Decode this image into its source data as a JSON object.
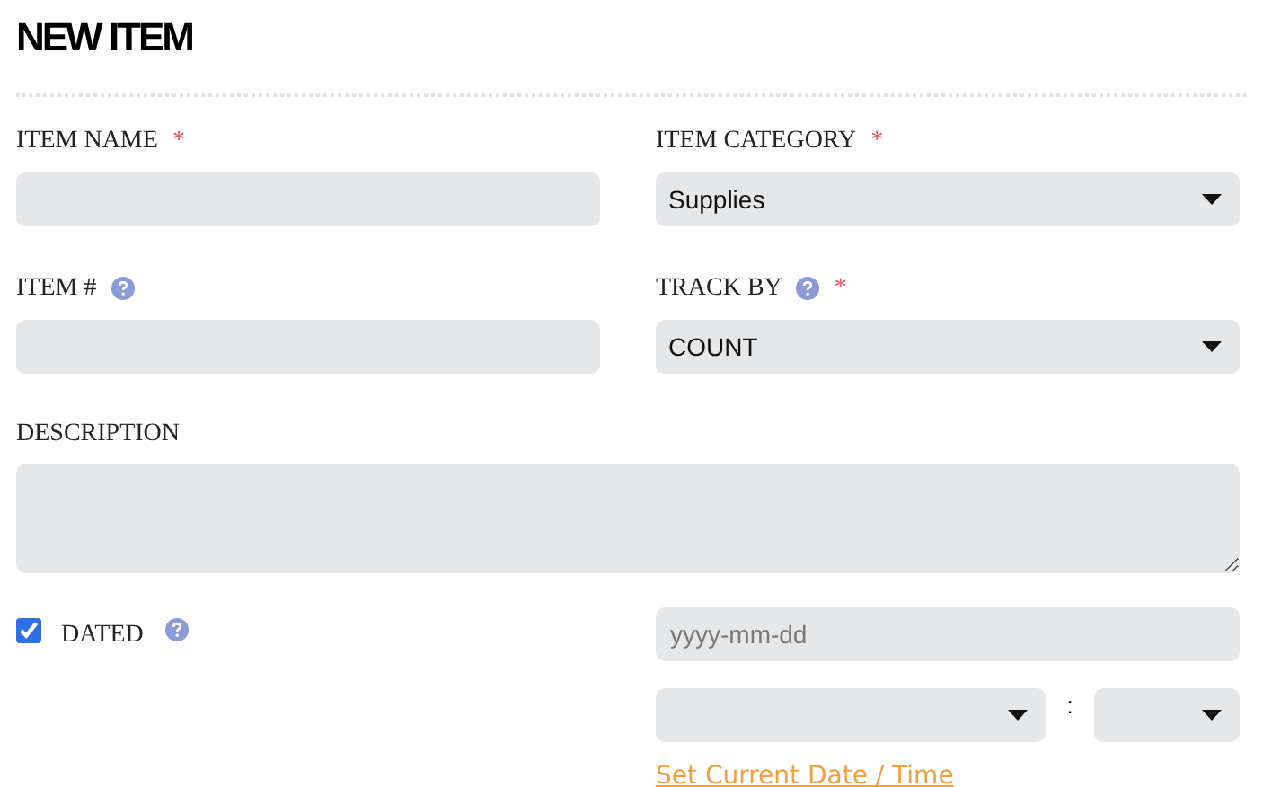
{
  "title": "NEW ITEM",
  "rows": [
    [
      {
        "kind": "text",
        "label": "ITEM NAME",
        "required": true,
        "help": false
      },
      {
        "kind": "select",
        "label": "ITEM CATEGORY",
        "required": true,
        "help": false,
        "value": "Supplies"
      }
    ],
    [
      {
        "kind": "text",
        "label": "ITEM #",
        "required": false,
        "help": true
      },
      {
        "kind": "select",
        "label": "TRACK BY",
        "required": true,
        "help": true,
        "value": "COUNT"
      }
    ]
  ],
  "required_mark": "*",
  "description": {
    "label": "DESCRIPTION"
  },
  "dated": {
    "label": "DATED",
    "checked": true,
    "help": true
  },
  "date": {
    "placeholder": "yyyy-mm-dd"
  },
  "time_separator": ":",
  "set_current": "Set Current Date / Time"
}
